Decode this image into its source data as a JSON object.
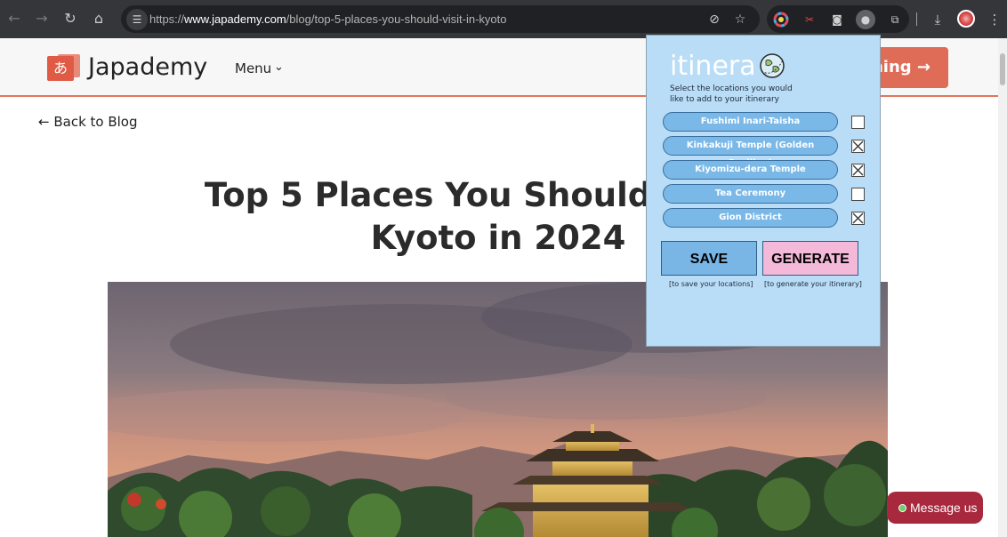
{
  "browser": {
    "url_prefix": "https://",
    "url_host": "www.japademy.com",
    "url_path": "/blog/top-5-places-you-should-visit-in-kyoto",
    "icons": {
      "back": "arrow-left-icon",
      "forward": "arrow-right-icon",
      "reload": "reload-icon",
      "home": "home-icon",
      "site_info": "tune-icon",
      "eye_off": "eye-off-icon",
      "star": "star-icon",
      "color_picker": "color-wheel-icon",
      "scissors": "scissors-icon",
      "camera": "camera-icon",
      "itinera_ext": "itinera-extension-icon",
      "extensions": "puzzle-icon",
      "download": "download-icon",
      "more": "more-vert-icon"
    }
  },
  "site": {
    "logo_glyph": "あ",
    "logo_text": "Japademy",
    "menu_label": "Menu",
    "cta_label": "ning →",
    "back_link": "← Back to Blog",
    "title": "Top 5 Places You Should Visit in Kyoto in 2024",
    "message_label": "Message us",
    "accent": "#e3735e",
    "cta_color": "#df6c57",
    "message_color": "#a8283e"
  },
  "popup": {
    "brand": "itinera",
    "subtitle": "Select the locations you would like to add to your itinerary",
    "locations": [
      {
        "label": "Fushimi Inari-Taisha",
        "checked": false
      },
      {
        "label": "Kinkakuji Temple (Golden Pavilion)",
        "checked": true
      },
      {
        "label": "Kiyomizu-dera Temple",
        "checked": true
      },
      {
        "label": "Tea Ceremony",
        "checked": false
      },
      {
        "label": "Gion District",
        "checked": true
      }
    ],
    "save_label": "SAVE",
    "save_hint": "[to save your locations]",
    "generate_label": "GENERATE",
    "generate_hint": "[to generate your itinerary]",
    "bg_color": "#b9dcf7",
    "save_color": "#79b6e6",
    "generate_color": "#f4b9d9"
  }
}
